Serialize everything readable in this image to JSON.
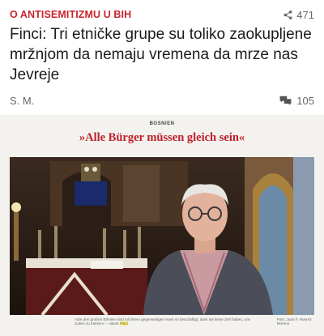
{
  "article": {
    "category": "O ANTISEMITIZMU U BIH",
    "share_count": "471",
    "title": "Finci: Tri etničke grupe su toliko zaokupljene mržnjom da nemaju vremena da mrze nas Jevreje",
    "author": "S. M.",
    "comment_count": "105"
  },
  "embedded": {
    "kicker": "BOSNIEN",
    "title": "»Alle Bürger müssen gleich sein«",
    "caption": "»Die drei großen Ethnien sind mit ihrem gegenseitigen Hass so beschäftigt, dass sie keine Zeit haben, uns Juden zu hassen« – Jakob",
    "caption_name": "Finci",
    "photo_credit": "Foto: Juan F. Alvarez Moreno"
  },
  "colors": {
    "accent": "#c9252c",
    "card_title": "#c01f2a"
  },
  "icons": {
    "share": "share-icon",
    "comments": "comments-icon"
  }
}
